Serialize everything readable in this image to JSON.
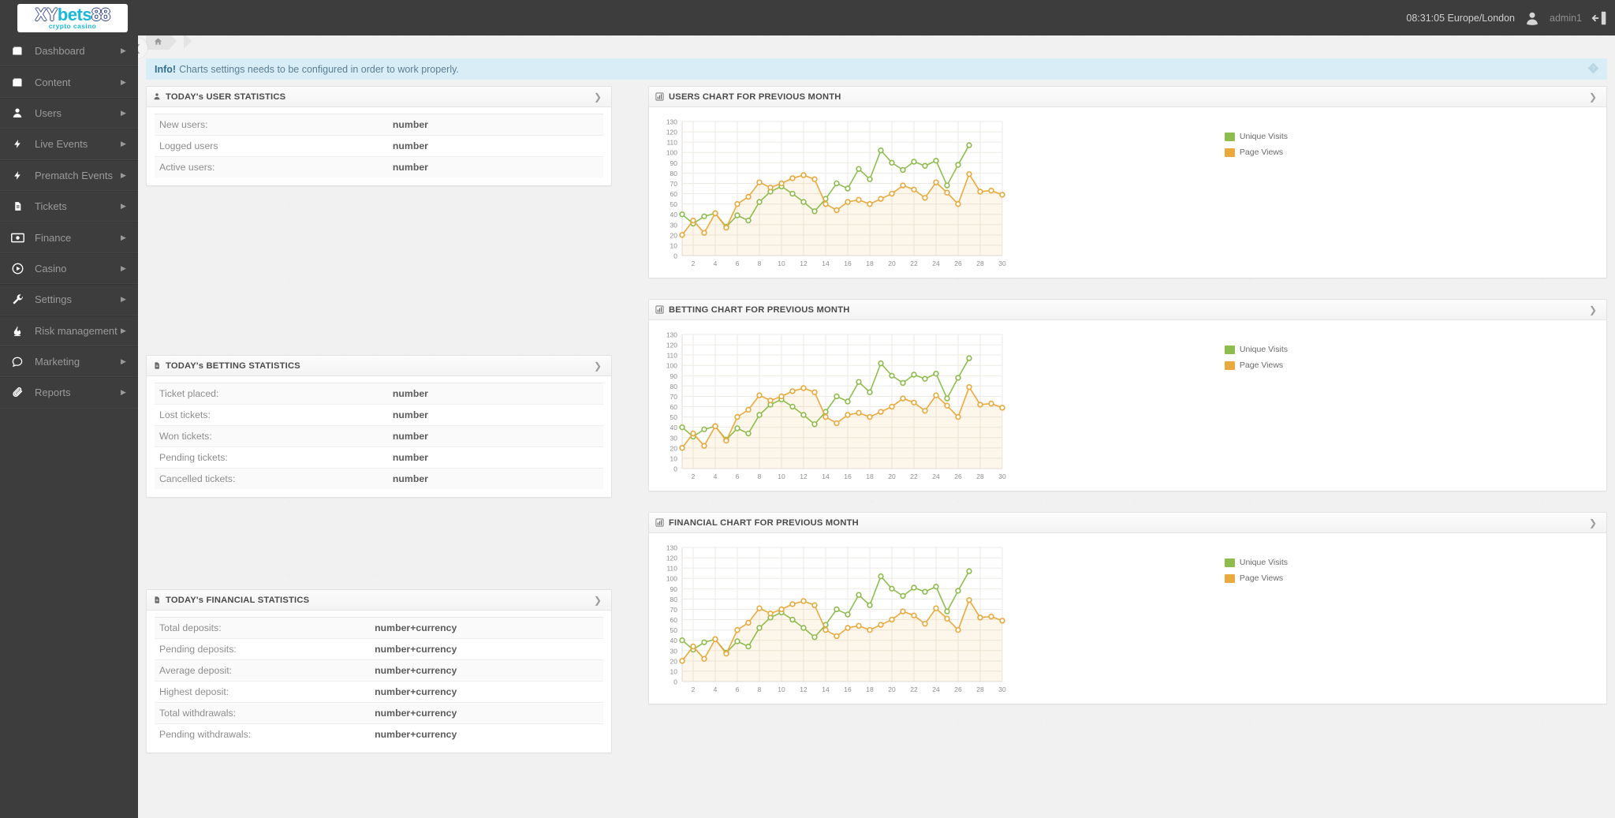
{
  "topbar": {
    "logo_xy": "XY",
    "logo_bets": "bets",
    "logo_88": "88",
    "logo_sub": "crypto casino",
    "clock": "08:31:05 Europe/London",
    "user": "admin1"
  },
  "sidebar": {
    "items": [
      {
        "label": "Dashboard",
        "icon": "book-icon"
      },
      {
        "label": "Content",
        "icon": "book-icon"
      },
      {
        "label": "Users",
        "icon": "user-icon"
      },
      {
        "label": "Live Events",
        "icon": "bolt-icon"
      },
      {
        "label": "Prematch Events",
        "icon": "bolt-icon"
      },
      {
        "label": "Tickets",
        "icon": "file-icon"
      },
      {
        "label": "Finance",
        "icon": "money-icon"
      },
      {
        "label": "Casino",
        "icon": "play-circle-icon"
      },
      {
        "label": "Settings",
        "icon": "wrench-icon"
      },
      {
        "label": "Risk management",
        "icon": "fire-icon"
      },
      {
        "label": "Marketing",
        "icon": "comment-icon"
      },
      {
        "label": "Reports",
        "icon": "paperclip-icon"
      }
    ]
  },
  "breadcrumb": {
    "home_icon": "home-icon"
  },
  "alert": {
    "strong": "Info!",
    "text": "Charts settings needs to be configured in order to work properly."
  },
  "panels": {
    "user_stats": {
      "title": "TODAY's USER STATISTICS",
      "icon": "user-stats-icon",
      "rows": [
        {
          "label": "New users:",
          "value": "number"
        },
        {
          "label": "Logged users",
          "value": "number"
        },
        {
          "label": "Active users:",
          "value": "number"
        }
      ]
    },
    "betting_stats": {
      "title": "TODAY's BETTING STATISTICS",
      "icon": "file-icon",
      "rows": [
        {
          "label": "Ticket placed:",
          "value": "number"
        },
        {
          "label": "Lost tickets:",
          "value": "number"
        },
        {
          "label": "Won tickets:",
          "value": "number"
        },
        {
          "label": "Pending tickets:",
          "value": "number"
        },
        {
          "label": "Cancelled tickets:",
          "value": "number"
        }
      ]
    },
    "financial_stats": {
      "title": "TODAY's FINANCIAL STATISTICS",
      "icon": "file-icon",
      "rows": [
        {
          "label": "Total deposits:",
          "value": "number+currency"
        },
        {
          "label": "Pending deposits:",
          "value": "number+currency"
        },
        {
          "label": "Average deposit:",
          "value": "number+currency"
        },
        {
          "label": "Highest deposit:",
          "value": "number+currency"
        },
        {
          "label": "Total withdrawals:",
          "value": "number+currency"
        },
        {
          "label": "Pending withdrawals:",
          "value": "number+currency"
        }
      ]
    },
    "users_chart": {
      "title": "USERS CHART FOR PREVIOUS MONTH",
      "icon": "bar-chart-icon"
    },
    "betting_chart": {
      "title": "BETTING CHART FOR PREVIOUS MONTH",
      "icon": "bar-chart-icon"
    },
    "financial_chart": {
      "title": "FINANCIAL CHART FOR PREVIOUS MONTH",
      "icon": "bar-chart-icon"
    }
  },
  "colors": {
    "unique_visits": "#8ebd4e",
    "page_views": "#eaa93d",
    "sidebar_bg": "#3d3d3d",
    "alert_bg": "#d9edf7",
    "page_bg": "#f1f1f1"
  },
  "chart_data": {
    "type": "line",
    "title": "USERS CHART FOR PREVIOUS MONTH",
    "xlabel": "",
    "ylabel": "",
    "ylim": [
      0,
      130
    ],
    "ytick_step": 10,
    "yticks": [
      0,
      10,
      20,
      30,
      40,
      50,
      60,
      70,
      80,
      90,
      100,
      110,
      120,
      130
    ],
    "xticks": [
      2,
      4,
      6,
      8,
      10,
      12,
      14,
      16,
      18,
      20,
      22,
      24,
      26,
      28,
      30
    ],
    "x": [
      1,
      2,
      3,
      4,
      5,
      6,
      7,
      8,
      9,
      10,
      11,
      12,
      13,
      14,
      15,
      16,
      17,
      18,
      19,
      20,
      21,
      22,
      23,
      24,
      25,
      26,
      27,
      28,
      29,
      30
    ],
    "grid": true,
    "legend_position": "top-right",
    "series": [
      {
        "name": "Unique Visits",
        "color": "#8ebd4e",
        "values": [
          40,
          31,
          38,
          41,
          28,
          39,
          34,
          52,
          62,
          67,
          60,
          52,
          43,
          55,
          70,
          65,
          84,
          74,
          102,
          90,
          83,
          91,
          87,
          92,
          68,
          88,
          107,
          null,
          null,
          null
        ]
      },
      {
        "name": "Page Views",
        "color": "#eaa93d",
        "values": [
          20,
          34,
          22,
          41,
          27,
          50,
          57,
          71,
          66,
          70,
          75,
          78,
          74,
          50,
          44,
          52,
          54,
          50,
          55,
          60,
          68,
          64,
          56,
          71,
          61,
          50,
          79,
          62,
          63,
          59
        ]
      }
    ]
  }
}
